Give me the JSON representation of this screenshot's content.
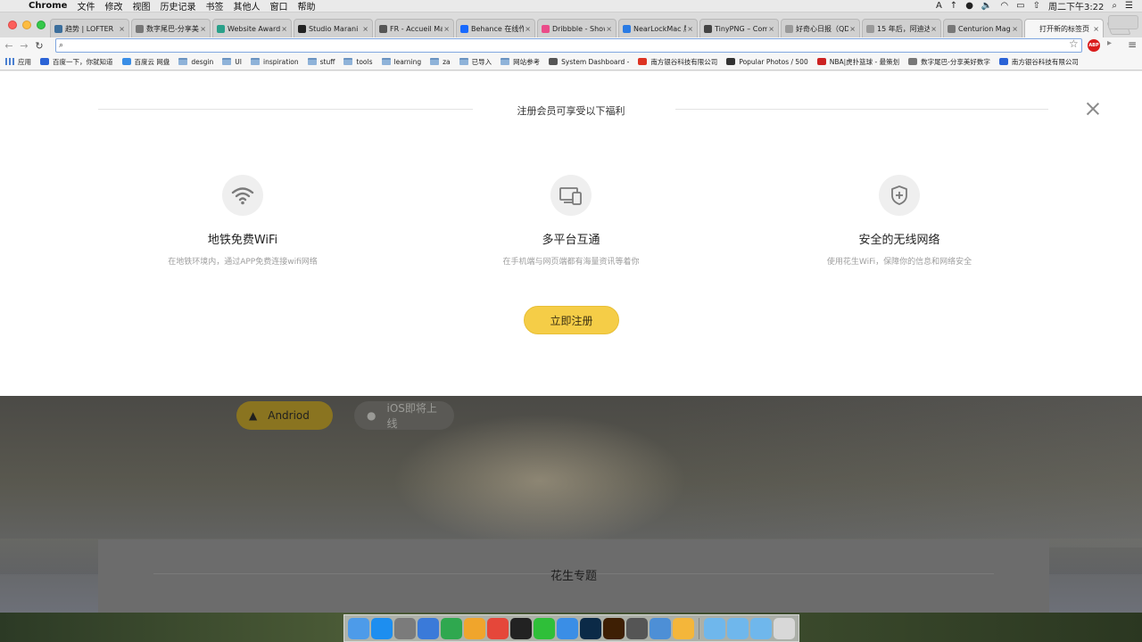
{
  "menubar": {
    "app": "Chrome",
    "items": [
      "文件",
      "修改",
      "视图",
      "历史记录",
      "书签",
      "其他人",
      "窗口",
      "帮助"
    ],
    "clock": "周二下午3:22"
  },
  "tabs": [
    {
      "title": "趋势 | LOFTER（",
      "color": "#3b6e9c"
    },
    {
      "title": "数字尾巴-分享美",
      "color": "#777"
    },
    {
      "title": "Website Awards",
      "color": "#2aa08a"
    },
    {
      "title": "Studio Marani",
      "color": "#222"
    },
    {
      "title": "FR - Accueil Mar",
      "color": "#555"
    },
    {
      "title": "Behance 在线作",
      "color": "#1769ff"
    },
    {
      "title": "Dribbble - Show",
      "color": "#ea4c89"
    },
    {
      "title": "NearLockMac 版",
      "color": "#2a7be4"
    },
    {
      "title": "TinyPNG – Comp",
      "color": "#444"
    },
    {
      "title": "好奇心日报（QD",
      "color": "#999"
    },
    {
      "title": "15 年后，阿迪达",
      "color": "#999"
    },
    {
      "title": "Centurion Maga",
      "color": "#777"
    },
    {
      "title": "打开新的标签页",
      "color": "#f6f6f6"
    }
  ],
  "omnibox": {
    "value": "",
    "placeholder": ""
  },
  "bookmarks": [
    {
      "label": "应用",
      "kind": "apps"
    },
    {
      "label": "百度一下，你就知道",
      "kind": "fav",
      "color": "#2b63d6"
    },
    {
      "label": "百度云 网盘",
      "kind": "fav",
      "color": "#3a8ee6"
    },
    {
      "label": "desgin",
      "kind": "folder"
    },
    {
      "label": "UI",
      "kind": "folder"
    },
    {
      "label": "inspiration",
      "kind": "folder"
    },
    {
      "label": "stuff",
      "kind": "folder"
    },
    {
      "label": "tools",
      "kind": "folder"
    },
    {
      "label": "learning",
      "kind": "folder"
    },
    {
      "label": "za",
      "kind": "folder"
    },
    {
      "label": "已导入",
      "kind": "folder"
    },
    {
      "label": "网站参考",
      "kind": "folder"
    },
    {
      "label": "System Dashboard -",
      "kind": "fav",
      "color": "#555"
    },
    {
      "label": "南方银谷科技有限公司",
      "kind": "fav",
      "color": "#d32"
    },
    {
      "label": "Popular Photos / 500",
      "kind": "fav",
      "color": "#333"
    },
    {
      "label": "NBA|虎扑篮球 - 最策划",
      "kind": "fav",
      "color": "#c22"
    },
    {
      "label": "数字尾巴-分享美好数字",
      "kind": "fav",
      "color": "#777"
    },
    {
      "label": "南方银谷科技有限公司",
      "kind": "fav",
      "color": "#2b63d6"
    }
  ],
  "modal": {
    "header": "注册会员可享受以下福利",
    "features": [
      {
        "icon": "wifi-icon",
        "title": "地铁免费WiFi",
        "desc": "在地铁环境内，通过APP免费连接wifi网络"
      },
      {
        "icon": "multi-device-icon",
        "title": "多平台互通",
        "desc": "在手机端与网页端都有海量资讯等着你"
      },
      {
        "icon": "shield-plus-icon",
        "title": "安全的无线网络",
        "desc": "使用花生WiFi，保障你的信息和网络安全"
      }
    ],
    "cta": "立即注册"
  },
  "hero": {
    "android_label": "Andriod",
    "ios_label": "iOS即将上线"
  },
  "topics": {
    "title": "花生专题"
  },
  "dock": [
    {
      "name": "finder-icon",
      "color": "#4d9be9"
    },
    {
      "name": "app-store-icon",
      "color": "#1d8ef0"
    },
    {
      "name": "system-preferences-icon",
      "color": "#7b7b7b"
    },
    {
      "name": "keynote-icon",
      "color": "#3a7ad9"
    },
    {
      "name": "numbers-icon",
      "color": "#2fa84f"
    },
    {
      "name": "pages-icon",
      "color": "#f0a52c"
    },
    {
      "name": "chrome-icon",
      "color": "#e5473a"
    },
    {
      "name": "qq-icon",
      "color": "#222"
    },
    {
      "name": "wechat-icon",
      "color": "#2fbf39"
    },
    {
      "name": "mail-icon",
      "color": "#3a8ee6"
    },
    {
      "name": "photoshop-icon",
      "color": "#0b2a47"
    },
    {
      "name": "illustrator-icon",
      "color": "#3e1f04"
    },
    {
      "name": "weibo-icon",
      "color": "#555"
    },
    {
      "name": "preview-icon",
      "color": "#4d8fd6"
    },
    {
      "name": "sketch-icon",
      "color": "#f4b63a"
    },
    {
      "name": "applications-folder-icon",
      "color": "#6fb7ec"
    },
    {
      "name": "documents-folder-icon",
      "color": "#6fb7ec"
    },
    {
      "name": "downloads-folder-icon",
      "color": "#6fb7ec"
    },
    {
      "name": "trash-icon",
      "color": "#d8d8d8"
    }
  ],
  "colors": {
    "cta": "#f5cd47",
    "accent_android": "#8a7420"
  }
}
